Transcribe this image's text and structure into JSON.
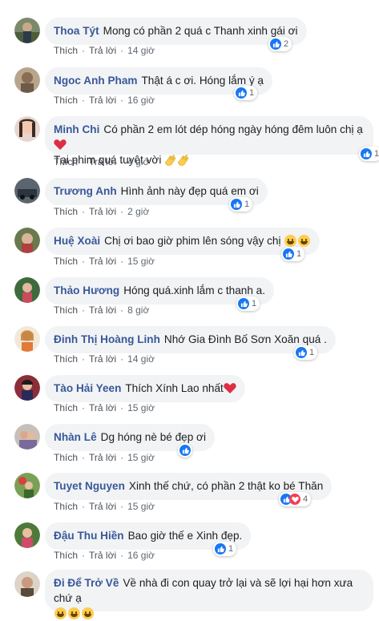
{
  "labels": {
    "like": "Thích",
    "reply": "Trả lời",
    "dot": "·"
  },
  "comments": [
    {
      "author": "Thoa Týt",
      "text": "Mong có phần 2 quá c Thanh xinh gái ơi",
      "time": "14 giờ",
      "count": "2"
    },
    {
      "author": "Ngoc Anh Pham",
      "text": "Thật á c ơi. Hóng lắm ý ạ",
      "time": "16 giờ",
      "count": "1"
    },
    {
      "author": "Minh Chi",
      "text": "Có phần 2 em lót dép hóng ngày hóng đêm luôn chị ạ",
      "text2": "Tại phim quá tuyệt vời",
      "time": "4 giờ",
      "count": "1"
    },
    {
      "author": "Trương Anh",
      "text": "Hình ảnh này đẹp quá em ơi",
      "time": "2 giờ",
      "count": "1"
    },
    {
      "author": "Huệ Xoài",
      "text": "Chị ơi bao giờ phim lên sóng vậy chị",
      "time": "15 giờ",
      "count": "1"
    },
    {
      "author": "Thảo Hương",
      "text": "Hóng quá.xinh lắm c thanh a.",
      "time": "8 giờ",
      "count": "1"
    },
    {
      "author": "Đinh Thị Hoàng Linh",
      "text": "Nhớ Gia Đình Bố Sơn Xoăn quá .",
      "time": "14 giờ",
      "count": "1"
    },
    {
      "author": "Tào Hải Yeen",
      "text": "Thích Xính Lao nhất",
      "time": "15 giờ"
    },
    {
      "author": "Nhàn Lê",
      "text": "Dg hóng nè bé đẹp ơi",
      "time": "15 giờ"
    },
    {
      "author": "Tuyet Nguyen",
      "text": "Xinh thế chứ, có phần 2 thật ko bé Thăn",
      "time": "15 giờ",
      "count": "4"
    },
    {
      "author": "Đậu Thu Hiền",
      "text": "Bao giờ thế e Xinh đẹp.",
      "time": "16 giờ",
      "count": "1"
    },
    {
      "author": "Đi Để Trở Về",
      "text": "Về nhà đi con quay trở lại và sẽ lợi hại hơn xưa chứ ạ"
    }
  ],
  "colors": {
    "author": "#385898",
    "bubble": "#f2f3f5",
    "like": "#1877f2",
    "love": "#f33e58"
  }
}
